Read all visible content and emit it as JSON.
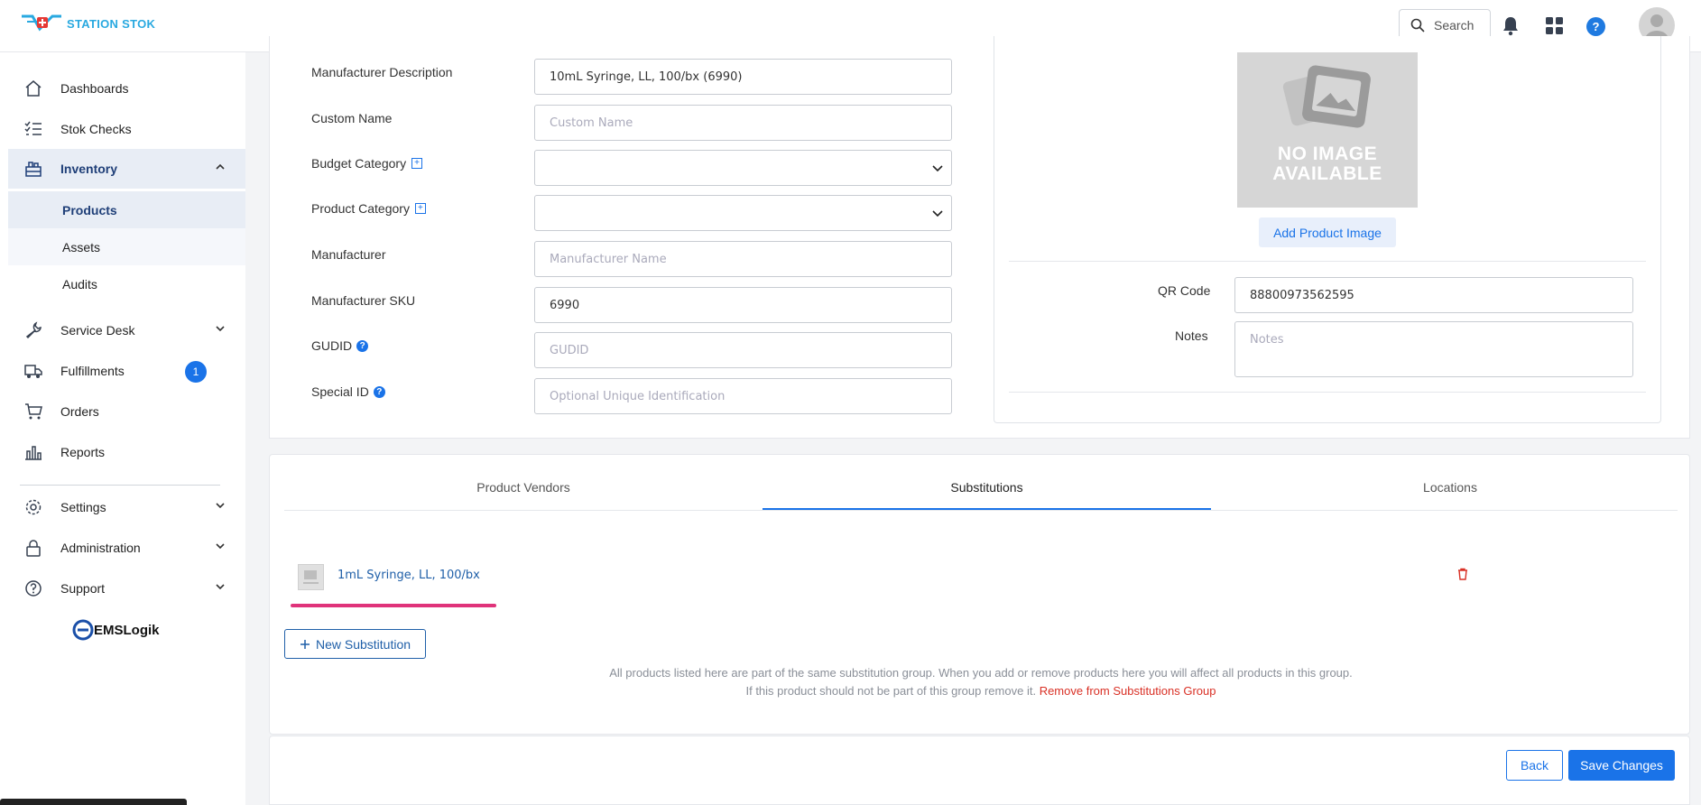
{
  "app": {
    "name": "STATION STOK"
  },
  "header": {
    "search_label": "Search",
    "help_glyph": "?"
  },
  "sidebar": {
    "items": [
      {
        "label": "Dashboards",
        "icon": "home-icon"
      },
      {
        "label": "Stok Checks",
        "icon": "checklist-icon"
      },
      {
        "label": "Inventory",
        "icon": "inventory-icon",
        "expanded": true
      },
      {
        "label": "Service Desk",
        "icon": "wrench-icon"
      },
      {
        "label": "Fulfillments",
        "icon": "truck-icon",
        "badge": "1"
      },
      {
        "label": "Orders",
        "icon": "cart-icon"
      },
      {
        "label": "Reports",
        "icon": "bar-chart-icon"
      },
      {
        "label": "Settings",
        "icon": "gear-icon"
      },
      {
        "label": "Administration",
        "icon": "lock-icon"
      },
      {
        "label": "Support",
        "icon": "help-circle-icon"
      }
    ],
    "inventory_sub": [
      {
        "label": "Products"
      },
      {
        "label": "Assets"
      },
      {
        "label": "Audits"
      }
    ],
    "footer_logo": "EMSLogik"
  },
  "form": {
    "manufacturer_description": {
      "label": "Manufacturer Description",
      "value": "10mL Syringe, LL, 100/bx (6990)"
    },
    "custom_name": {
      "label": "Custom Name",
      "placeholder": "Custom Name"
    },
    "budget_category": {
      "label": "Budget Category",
      "value": ""
    },
    "product_category": {
      "label": "Product Category",
      "value": ""
    },
    "manufacturer": {
      "label": "Manufacturer",
      "placeholder": "Manufacturer Name"
    },
    "manufacturer_sku": {
      "label": "Manufacturer SKU",
      "value": "6990"
    },
    "gudid": {
      "label": "GUDID",
      "placeholder": "GUDID"
    },
    "special_id": {
      "label": "Special ID",
      "placeholder": "Optional Unique Identification"
    }
  },
  "image_panel": {
    "no_image_line1": "NO IMAGE",
    "no_image_line2": "AVAILABLE",
    "add_image_label": "Add Product Image",
    "qr_label": "QR Code",
    "qr_value": "88800973562595",
    "notes_label": "Notes",
    "notes_placeholder": "Notes"
  },
  "tabs": [
    {
      "label": "Product Vendors"
    },
    {
      "label": "Substitutions",
      "active": true
    },
    {
      "label": "Locations"
    }
  ],
  "substitutions": {
    "items": [
      {
        "label": "1mL Syringe, LL, 100/bx"
      }
    ],
    "new_button": "New Substitution",
    "note_line1": "All products listed here are part of the same substitution group. When you add or remove products here you will affect all products in this group.",
    "note_line2": "If this product should not be part of this group remove it.",
    "remove_link": "Remove from Substitutions Group"
  },
  "footer": {
    "back_label": "Back",
    "save_label": "Save Changes"
  },
  "colors": {
    "primary": "#1a73e8",
    "brand": "#29a9e0",
    "danger": "#d93025",
    "highlight": "#e0337a"
  }
}
